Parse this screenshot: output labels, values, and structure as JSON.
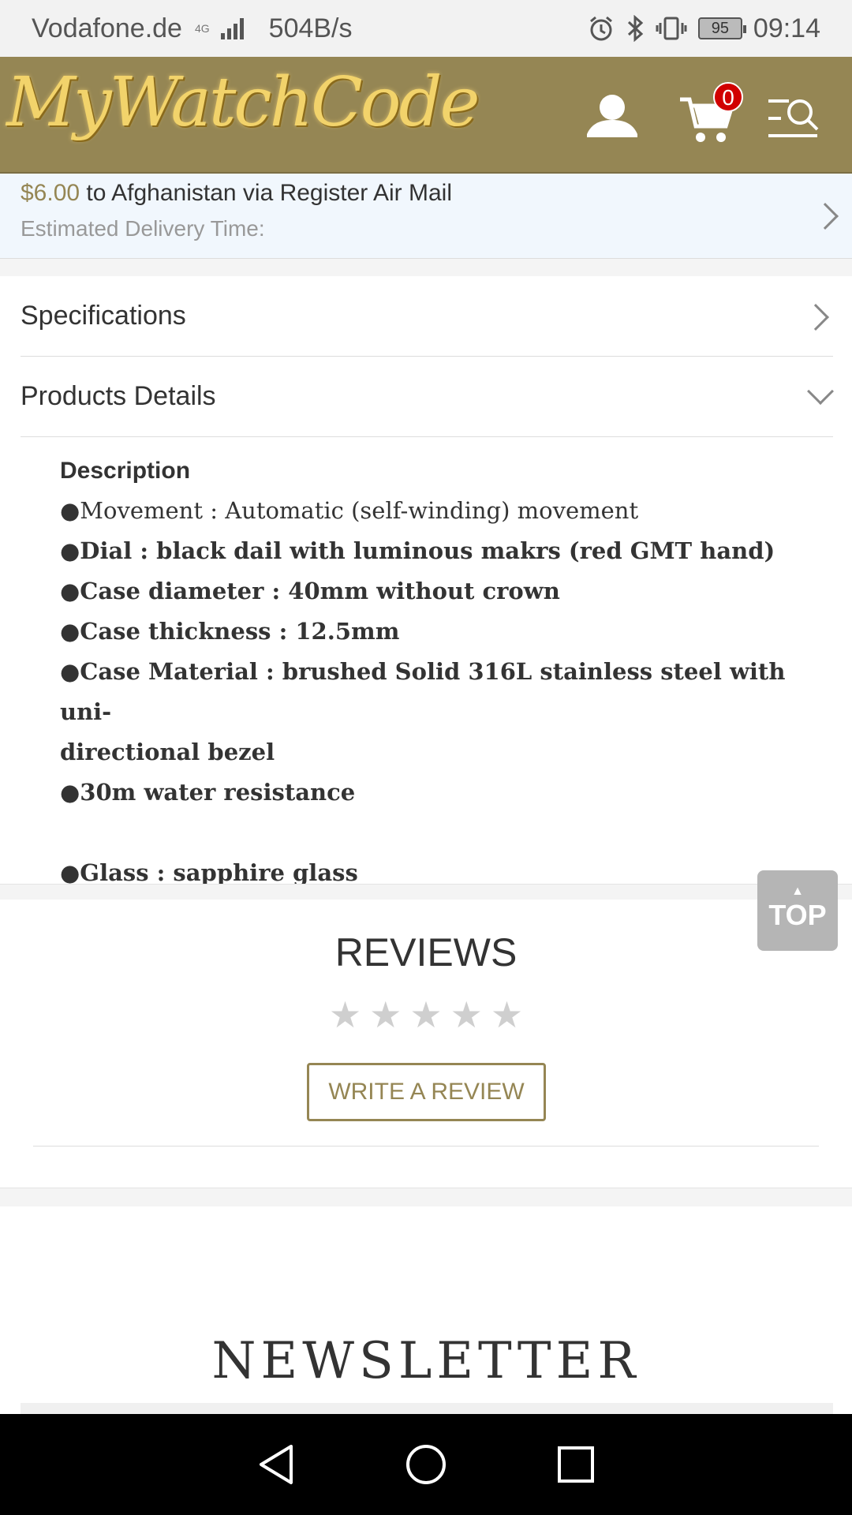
{
  "status_bar": {
    "carrier": "Vodafone.de",
    "network_type": "4G",
    "speed": "504B/s",
    "battery": "95",
    "time": "09:14"
  },
  "header": {
    "logo_text": "MyWatchCode",
    "cart_count": "0",
    "brand_color": "#958654"
  },
  "shipping": {
    "price": "$6.00",
    "destination_text": " to Afghanistan via Register Air Mail",
    "delivery_label": "Estimated Delivery Time:"
  },
  "accordion": {
    "specifications": "Specifications",
    "products_details": "Products Details"
  },
  "description": {
    "title": "Description",
    "lines": [
      "●Movement : Automatic (self-winding) movement",
      "●Dial :  black dail with luminous makrs (red GMT hand)",
      "●Case diameter : 40mm without crown",
      "●Case thickness : 12.5mm",
      "●Case Material : brushed Solid 316L stainless steel with uni-",
      "directional bezel",
      "●30m water resistance",
      "",
      "●Glass : sapphire glass"
    ]
  },
  "top_button": {
    "label": "TOP"
  },
  "reviews": {
    "title": "REVIEWS",
    "rating": 0,
    "max_rating": 5,
    "write_review": "WRITE A REVIEW"
  },
  "newsletter": {
    "title": "NEWSLETTER"
  }
}
